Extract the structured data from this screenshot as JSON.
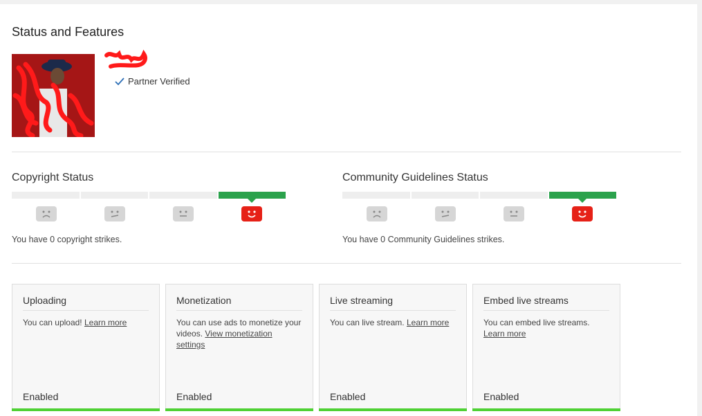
{
  "page": {
    "title": "Status and Features"
  },
  "channel": {
    "verified_label": "Partner Verified"
  },
  "copyright": {
    "title": "Copyright Status",
    "text": "You have 0 copyright strikes.",
    "active_index": 3
  },
  "community": {
    "title": "Community Guidelines Status",
    "text": "You have 0 Community Guidelines strikes.",
    "active_index": 3
  },
  "features": [
    {
      "title": "Uploading",
      "desc": "You can upload!",
      "link": "Learn more",
      "state": "Enabled"
    },
    {
      "title": "Monetization",
      "desc": "You can use ads to monetize your videos.",
      "link": "View monetization settings",
      "state": "Enabled"
    },
    {
      "title": "Live streaming",
      "desc": "You can live stream.",
      "link": "Learn more",
      "state": "Enabled"
    },
    {
      "title": "Embed live streams",
      "desc": "You can embed live streams.",
      "link": "Learn more",
      "state": "Enabled"
    }
  ],
  "colors": {
    "good_green": "#2ba24c",
    "enabled_green": "#4fd135",
    "youtube_red": "#e62117",
    "inactive_gray": "#d6d6d6"
  }
}
